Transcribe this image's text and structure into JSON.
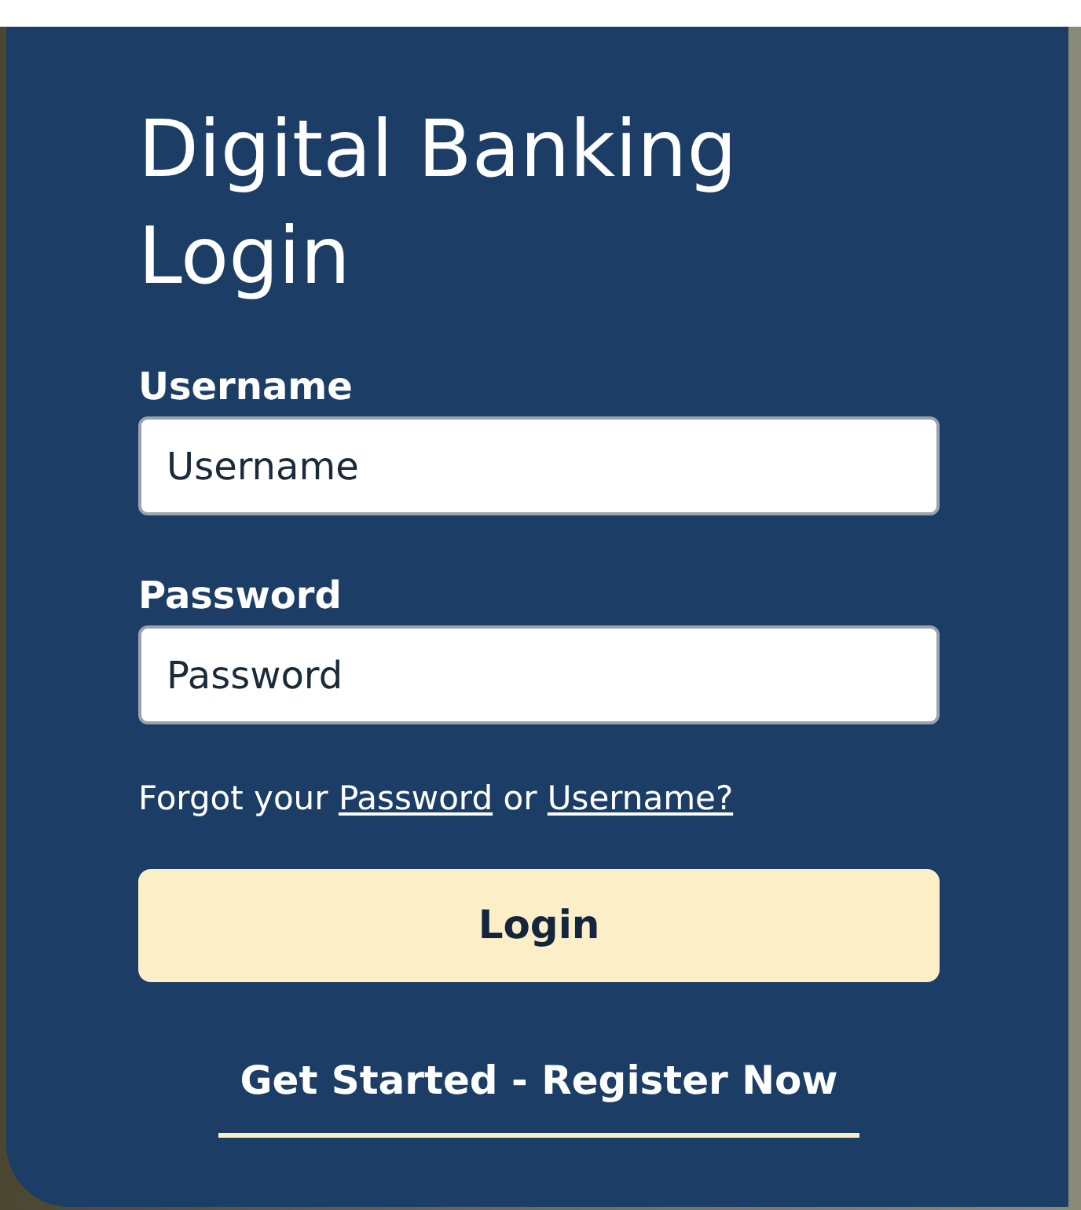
{
  "title": "Digital Banking Login",
  "fields": [
    {
      "label": "Username",
      "placeholder": "Username"
    },
    {
      "label": "Password",
      "placeholder": "Password"
    }
  ],
  "forgot": [
    {
      "kind": "text",
      "text": "Forgot your"
    },
    {
      "kind": "link",
      "text": "Password"
    },
    {
      "kind": "text",
      "text": "or"
    },
    {
      "kind": "link",
      "text": "Username?"
    }
  ],
  "login_button": "Login",
  "register_link": "Get Started - Register Now"
}
